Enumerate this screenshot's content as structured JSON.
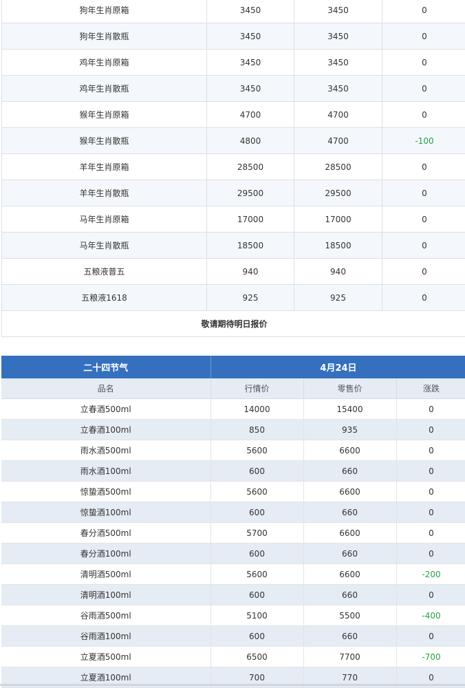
{
  "shengxiao_table": {
    "rows": [
      {
        "name": "狗年生肖原箱",
        "market": "3450",
        "retail": "3450",
        "change": "0"
      },
      {
        "name": "狗年生肖散瓶",
        "market": "3450",
        "retail": "3450",
        "change": "0"
      },
      {
        "name": "鸡年生肖原箱",
        "market": "3450",
        "retail": "3450",
        "change": "0"
      },
      {
        "name": "鸡年生肖散瓶",
        "market": "3450",
        "retail": "3450",
        "change": "0"
      },
      {
        "name": "猴年生肖原箱",
        "market": "4700",
        "retail": "4700",
        "change": "0"
      },
      {
        "name": "猴年生肖散瓶",
        "market": "4800",
        "retail": "4700",
        "change": "-100"
      },
      {
        "name": "羊年生肖原箱",
        "market": "28500",
        "retail": "28500",
        "change": "0"
      },
      {
        "name": "羊年生肖散瓶",
        "market": "29500",
        "retail": "29500",
        "change": "0"
      },
      {
        "name": "马年生肖原箱",
        "market": "17000",
        "retail": "17000",
        "change": "0"
      },
      {
        "name": "马年生肖散瓶",
        "market": "18500",
        "retail": "18500",
        "change": "0"
      },
      {
        "name": "五粮液普五",
        "market": "940",
        "retail": "940",
        "change": "0"
      },
      {
        "name": "五粮液1618",
        "market": "925",
        "retail": "925",
        "change": "0"
      }
    ],
    "note": "敬请期待明日报价"
  },
  "solar_terms_table": {
    "title": "二十四节气",
    "date": "4月24日",
    "headers": {
      "name": "品名",
      "market": "行情价",
      "retail": "零售价",
      "change": "涨跌"
    },
    "rows": [
      {
        "name": "立春酒500ml",
        "market": "14000",
        "retail": "15400",
        "change": "0"
      },
      {
        "name": "立春酒100ml",
        "market": "850",
        "retail": "935",
        "change": "0"
      },
      {
        "name": "雨水酒500ml",
        "market": "5600",
        "retail": "6600",
        "change": "0"
      },
      {
        "name": "雨水酒100ml",
        "market": "600",
        "retail": "660",
        "change": "0"
      },
      {
        "name": "惊蛰酒500ml",
        "market": "5600",
        "retail": "6600",
        "change": "0"
      },
      {
        "name": "惊蛰酒100ml",
        "market": "600",
        "retail": "660",
        "change": "0"
      },
      {
        "name": "春分酒500ml",
        "market": "5700",
        "retail": "6600",
        "change": "0"
      },
      {
        "name": "春分酒100ml",
        "market": "600",
        "retail": "660",
        "change": "0"
      },
      {
        "name": "清明酒500ml",
        "market": "5600",
        "retail": "6600",
        "change": "-200"
      },
      {
        "name": "清明酒100ml",
        "market": "600",
        "retail": "660",
        "change": "0"
      },
      {
        "name": "谷雨酒500ml",
        "market": "5100",
        "retail": "5500",
        "change": "-400"
      },
      {
        "name": "谷雨酒100ml",
        "market": "600",
        "retail": "660",
        "change": "0"
      },
      {
        "name": "立夏酒500ml",
        "market": "6500",
        "retail": "7700",
        "change": "-700"
      },
      {
        "name": "立夏酒100ml",
        "market": "700",
        "retail": "770",
        "change": "0"
      }
    ]
  },
  "colors": {
    "header_blue": "#3470be",
    "subheader_bg": "#e6ecf4",
    "alt_row_bg": "#f4f8fd",
    "price_down": "#27a048"
  }
}
